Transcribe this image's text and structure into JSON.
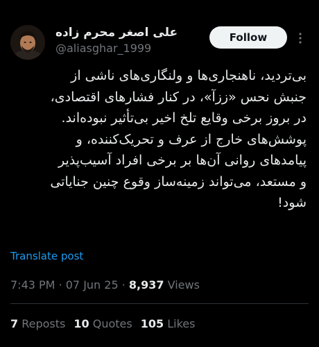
{
  "author": {
    "display_name": "علی اصغر محرم زاده",
    "handle": "@aliasghar_1999"
  },
  "actions": {
    "follow_label": "Follow",
    "more_icon": "more-vertical-icon"
  },
  "post": {
    "lines": [
      "بی‌تردید، ناهنجاری‌ها و ولنگاری‌های ناشی از",
      "جنبش نحس «ززآ»، در کنار فشارهای اقتصادی،",
      "در بروز برخی وقایع تلخ اخیر بی‌تأثیر نبوده‌اند.",
      "پوشش‌های خارج از عرف و تحریک‌کننده، و",
      "پیامدهای روانی آن‌ها بر برخی افراد آسیب‌پذیر",
      "و مستعد، می‌تواند زمینه‌ساز وقوع چنین جنایاتی",
      "شود!"
    ],
    "translate_label": "Translate post"
  },
  "meta": {
    "time": "7:43 PM",
    "separator": "·",
    "date": "07 Jun 25",
    "views_count": "8,937",
    "views_label": "Views"
  },
  "stats": {
    "reposts_count": "7",
    "reposts_label": "Reposts",
    "quotes_count": "10",
    "quotes_label": "Quotes",
    "likes_count": "105",
    "likes_label": "Likes"
  },
  "colors": {
    "background": "#000000",
    "primary_text": "#e7e9ea",
    "secondary_text": "#71767b",
    "link": "#1d9bf0",
    "follow_button_bg": "#eff3f4",
    "divider": "#2f3336"
  }
}
